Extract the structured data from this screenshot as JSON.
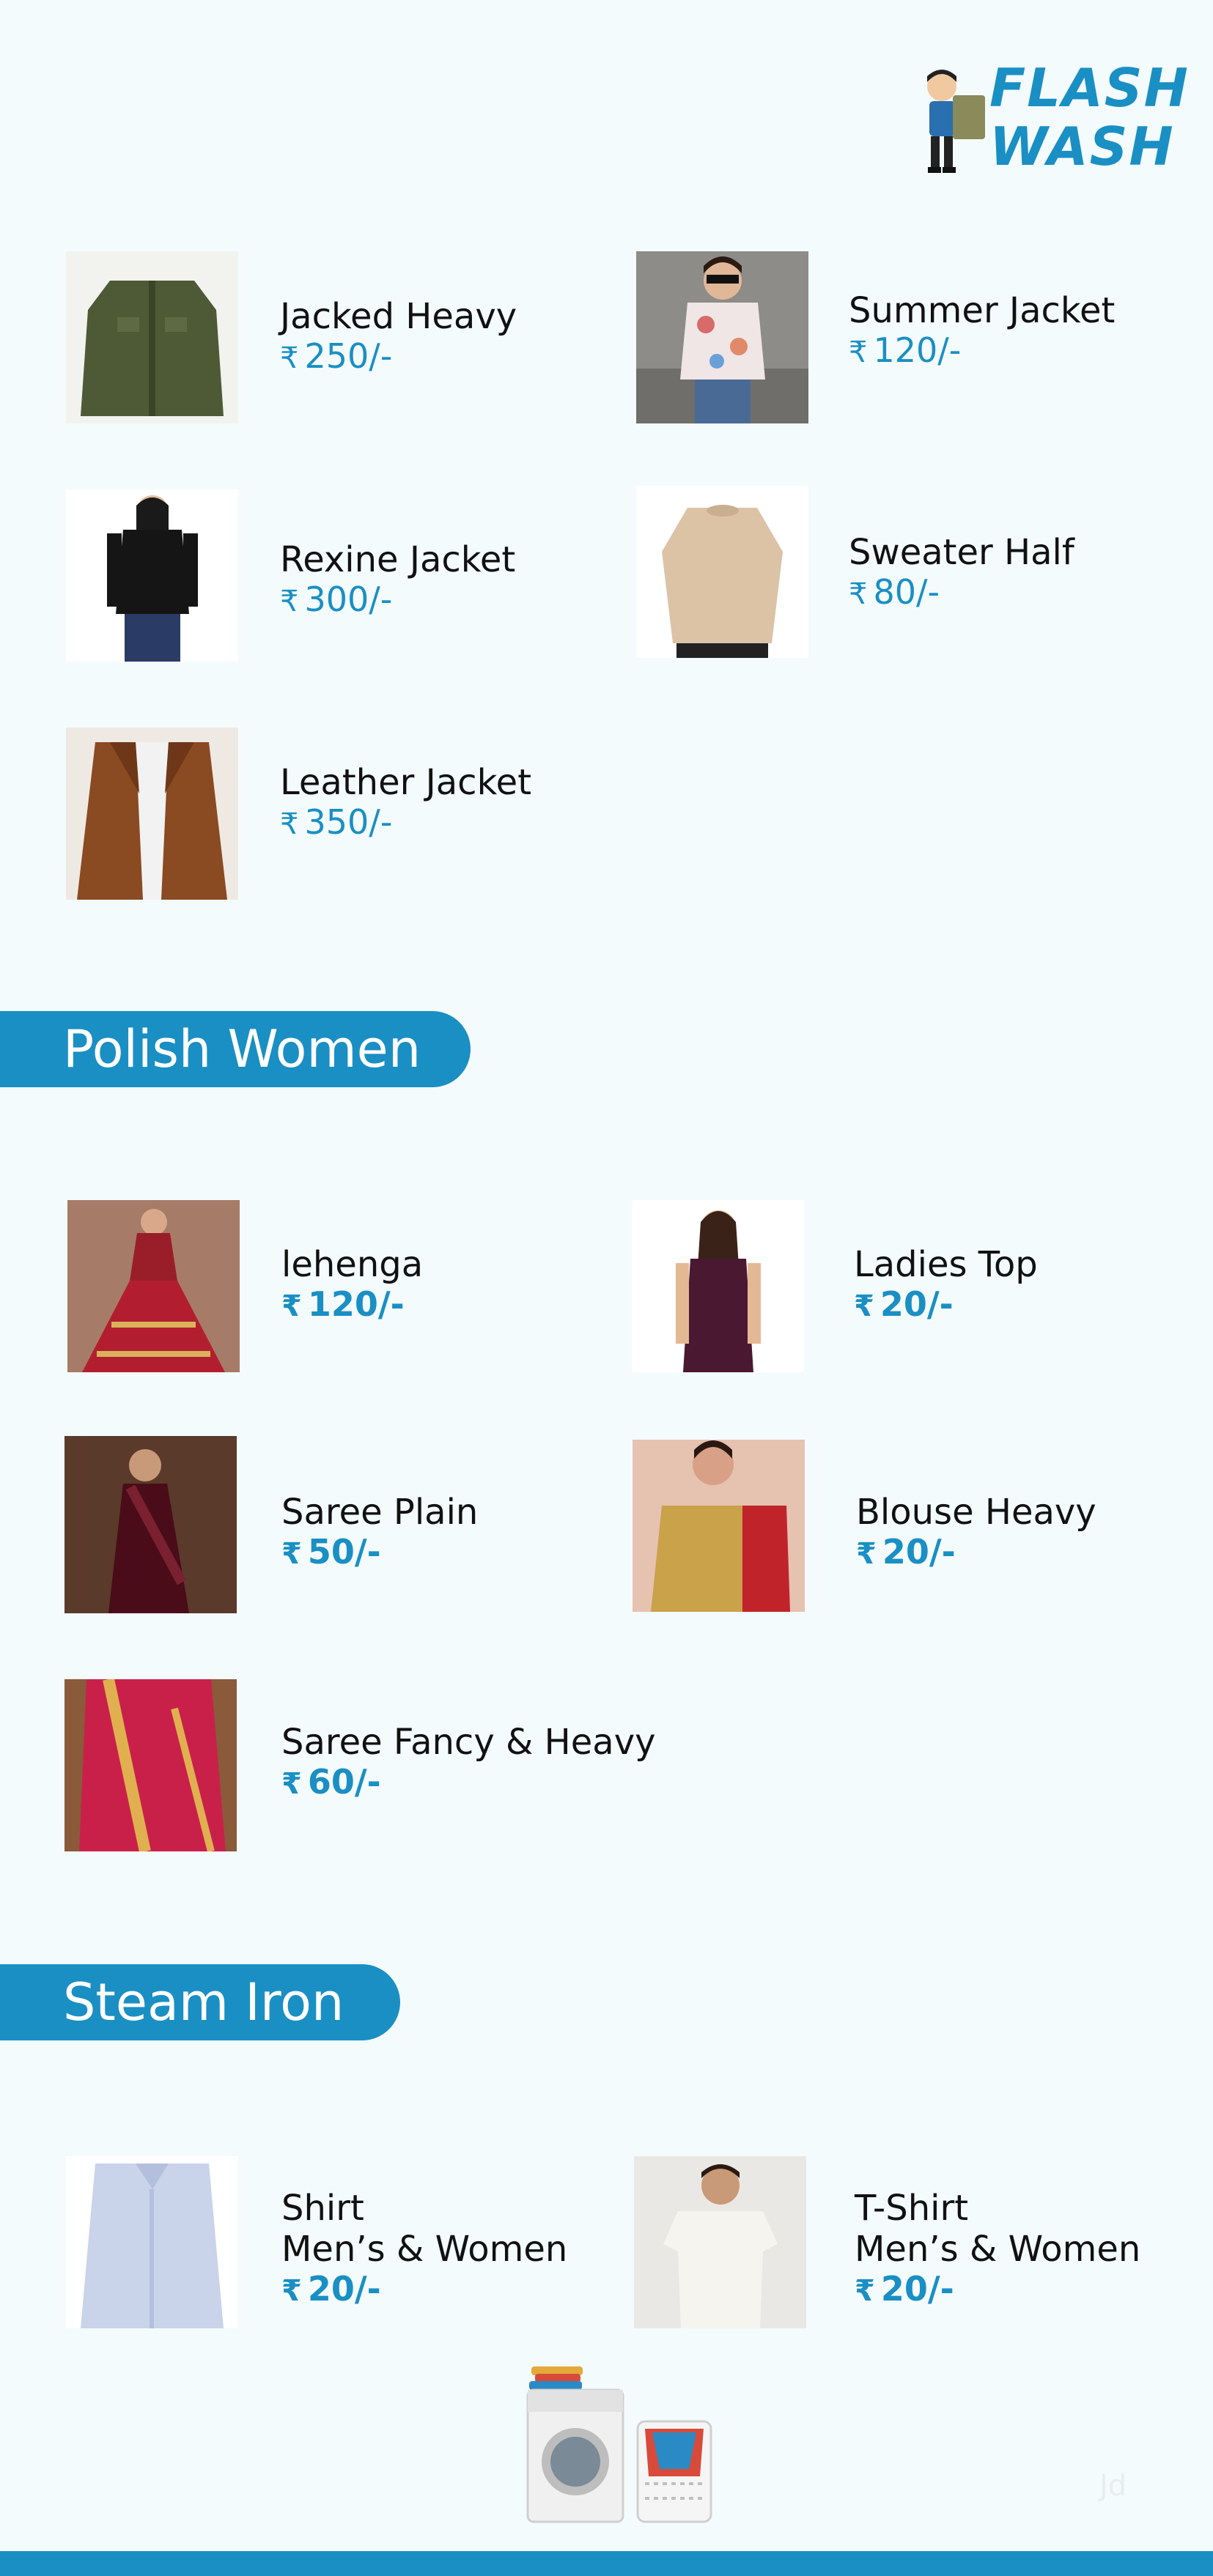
{
  "brand": {
    "line1": "FLASH",
    "line2": "WASH"
  },
  "sections": {
    "jackets": {
      "items": [
        {
          "name": "Jacked Heavy",
          "price": "250/-"
        },
        {
          "name": "Summer Jacket",
          "price": "120/-"
        },
        {
          "name": "Rexine Jacket",
          "price": "300/-"
        },
        {
          "name": "Sweater Half",
          "price": "80/-"
        },
        {
          "name": "Leather Jacket",
          "price": "350/-"
        }
      ]
    },
    "polish_women": {
      "title": "Polish Women",
      "items": [
        {
          "name": "lehenga",
          "price": "120/-"
        },
        {
          "name": "Ladies Top",
          "price": "20/-"
        },
        {
          "name": "Saree Plain",
          "price": "50/-"
        },
        {
          "name": "Blouse Heavy",
          "price": "20/-"
        },
        {
          "name": "Saree Fancy & Heavy",
          "price": "60/-"
        }
      ]
    },
    "steam_iron": {
      "title": "Steam Iron",
      "items": [
        {
          "name": "Shirt",
          "subtitle": "Men’s & Women",
          "price": "20/-"
        },
        {
          "name": "T-Shirt",
          "subtitle": "Men’s & Women",
          "price": "20/-"
        }
      ]
    }
  },
  "currency_symbol": "₹",
  "watermark": "Jd",
  "colors": {
    "accent": "#1a8fc4",
    "background": "#f4fbfd",
    "text": "#111111"
  }
}
